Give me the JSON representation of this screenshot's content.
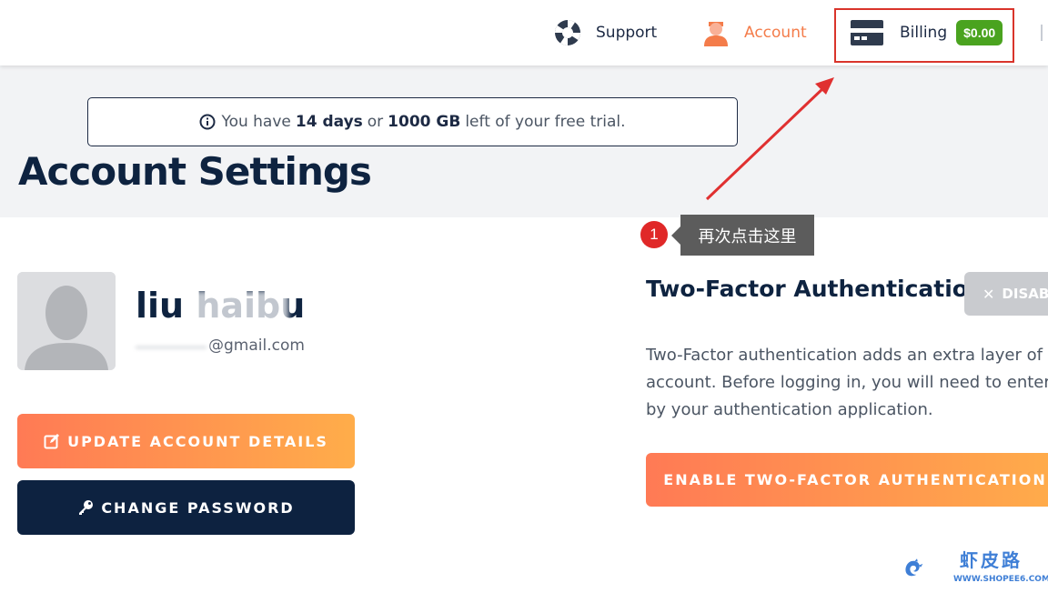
{
  "nav": {
    "support_label": "Support",
    "account_label": "Account",
    "billing_label": "Billing",
    "balance": "$0.00",
    "active_color": "#f47c4a",
    "balance_color": "#4aa31f"
  },
  "banner": {
    "prefix": "You have",
    "days": "14 days",
    "connector": "or",
    "data": "1000 GB",
    "suffix": "left of your free trial."
  },
  "page": {
    "title": "Account Settings"
  },
  "annotation": {
    "step": "1",
    "tooltip": "再次点击这里"
  },
  "profile": {
    "name": "liu haibu",
    "email": "@gmail.com",
    "update_button": "UPDATE ACCOUNT DETAILS",
    "password_button": "CHANGE PASSWORD"
  },
  "two_factor": {
    "title": "Two-Factor Authentication",
    "disable_button": "DISABLE",
    "description_lines": [
      "Two-Factor authentication adds an extra layer of se",
      "account. Before logging in, you will need to enter a",
      "by your authentication application."
    ],
    "enable_button": "ENABLE TWO-FACTOR AUTHENTICATION"
  },
  "watermark": {
    "text": "虾皮路",
    "url": "WWW.SHOPEE6.COM"
  }
}
